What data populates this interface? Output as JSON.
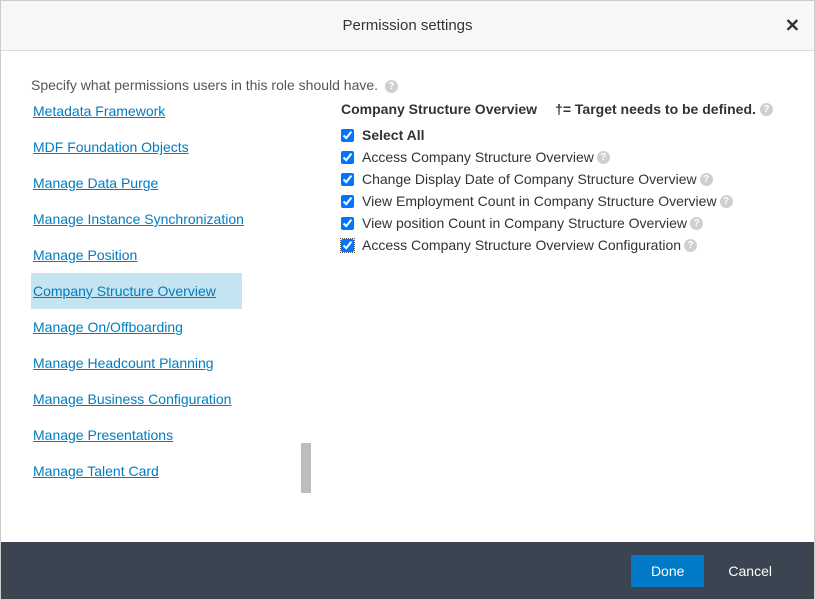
{
  "dialog": {
    "title": "Permission settings",
    "close_glyph": "✕"
  },
  "instruction": "Specify what permissions users in this role should have.",
  "sidebar": {
    "items": [
      {
        "label": "Metadata Framework",
        "selected": false
      },
      {
        "label": "MDF Foundation Objects",
        "selected": false
      },
      {
        "label": "Manage Data Purge",
        "selected": false
      },
      {
        "label": "Manage Instance Synchronization",
        "selected": false
      },
      {
        "label": "Manage Position",
        "selected": false
      },
      {
        "label": "Company Structure Overview",
        "selected": true
      },
      {
        "label": "Manage On/Offboarding",
        "selected": false
      },
      {
        "label": "Manage Headcount Planning",
        "selected": false
      },
      {
        "label": "Manage Business Configuration",
        "selected": false
      },
      {
        "label": "Manage Presentations",
        "selected": false
      },
      {
        "label": "Manage Talent Card",
        "selected": false
      }
    ]
  },
  "main": {
    "section_title": "Company Structure Overview",
    "target_note": "†= Target needs to be defined.",
    "select_all_label": "Select All",
    "permissions": [
      {
        "label": "Access Company Structure Overview",
        "checked": true,
        "help": true
      },
      {
        "label": "Change Display Date of Company Structure Overview",
        "checked": true,
        "help": true
      },
      {
        "label": "View Employment Count in Company Structure Overview",
        "checked": true,
        "help": true
      },
      {
        "label": "View position Count in Company Structure Overview",
        "checked": true,
        "help": true
      },
      {
        "label": "Access Company Structure Overview Configuration",
        "checked": true,
        "help": true,
        "focused": true
      }
    ]
  },
  "footer": {
    "done": "Done",
    "cancel": "Cancel"
  }
}
